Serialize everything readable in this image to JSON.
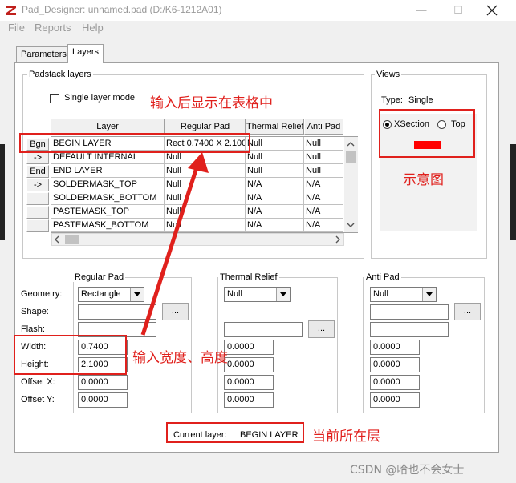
{
  "window": {
    "title": "Pad_Designer: unnamed.pad (D:/K6-1212A01)",
    "minimize": "—",
    "maximize": "☐"
  },
  "menu": {
    "file": "File",
    "reports": "Reports",
    "help": "Help"
  },
  "tabs": {
    "parameters": "Parameters",
    "layers": "Layers"
  },
  "padstack": {
    "group_title": "Padstack layers",
    "single_layer_mode": "Single layer mode",
    "columns": [
      "Layer",
      "Regular Pad",
      "Thermal Relief",
      "Anti Pad"
    ],
    "rows": [
      {
        "btn": "Bgn",
        "layer": "BEGIN LAYER",
        "regular": "Rect 0.7400 X 2.1000",
        "thermal": "Null",
        "anti": "Null"
      },
      {
        "btn": "->",
        "layer": "DEFAULT INTERNAL",
        "regular": "Null",
        "thermal": "Null",
        "anti": "Null"
      },
      {
        "btn": "End",
        "layer": "END LAYER",
        "regular": "Null",
        "thermal": "Null",
        "anti": "Null"
      },
      {
        "btn": "->",
        "layer": "SOLDERMASK_TOP",
        "regular": "Null",
        "thermal": "N/A",
        "anti": "N/A"
      },
      {
        "btn": "",
        "layer": "SOLDERMASK_BOTTOM",
        "regular": "Null",
        "thermal": "N/A",
        "anti": "N/A"
      },
      {
        "btn": "",
        "layer": "PASTEMASK_TOP",
        "regular": "Null",
        "thermal": "N/A",
        "anti": "N/A"
      },
      {
        "btn": "",
        "layer": "PASTEMASK_BOTTOM",
        "regular": "Null",
        "thermal": "N/A",
        "anti": "N/A"
      }
    ]
  },
  "views": {
    "group_title": "Views",
    "type_label": "Type:",
    "type_value": "Single",
    "xsection": "XSection",
    "top": "Top",
    "pad_color": "#ff0000"
  },
  "regular_pad": {
    "title": "Regular Pad",
    "geometry_label": "Geometry:",
    "geometry_value": "Rectangle",
    "shape_label": "Shape:",
    "flash_label": "Flash:",
    "width_label": "Width:",
    "width_value": "0.7400",
    "height_label": "Height:",
    "height_value": "2.1000",
    "offx_label": "Offset X:",
    "offx_value": "0.0000",
    "offy_label": "Offset Y:",
    "offy_value": "0.0000",
    "browse": "..."
  },
  "thermal": {
    "title": "Thermal Relief",
    "geometry_value": "Null",
    "browse": "...",
    "values": [
      "0.0000",
      "0.0000",
      "0.0000",
      "0.0000"
    ]
  },
  "anti": {
    "title": "Anti Pad",
    "geometry_value": "Null",
    "browse": "...",
    "values": [
      "0.0000",
      "0.0000",
      "0.0000",
      "0.0000"
    ]
  },
  "current_layer": {
    "label": "Current layer:",
    "value": "BEGIN LAYER"
  },
  "annotations": {
    "table_note": "输入后显示在表格中",
    "diagram_note": "示意图",
    "size_note": "输入宽度、高度",
    "layer_note": "当前所在层",
    "color": "#e0201c"
  },
  "watermark": "CSDN @哈也不会女士"
}
